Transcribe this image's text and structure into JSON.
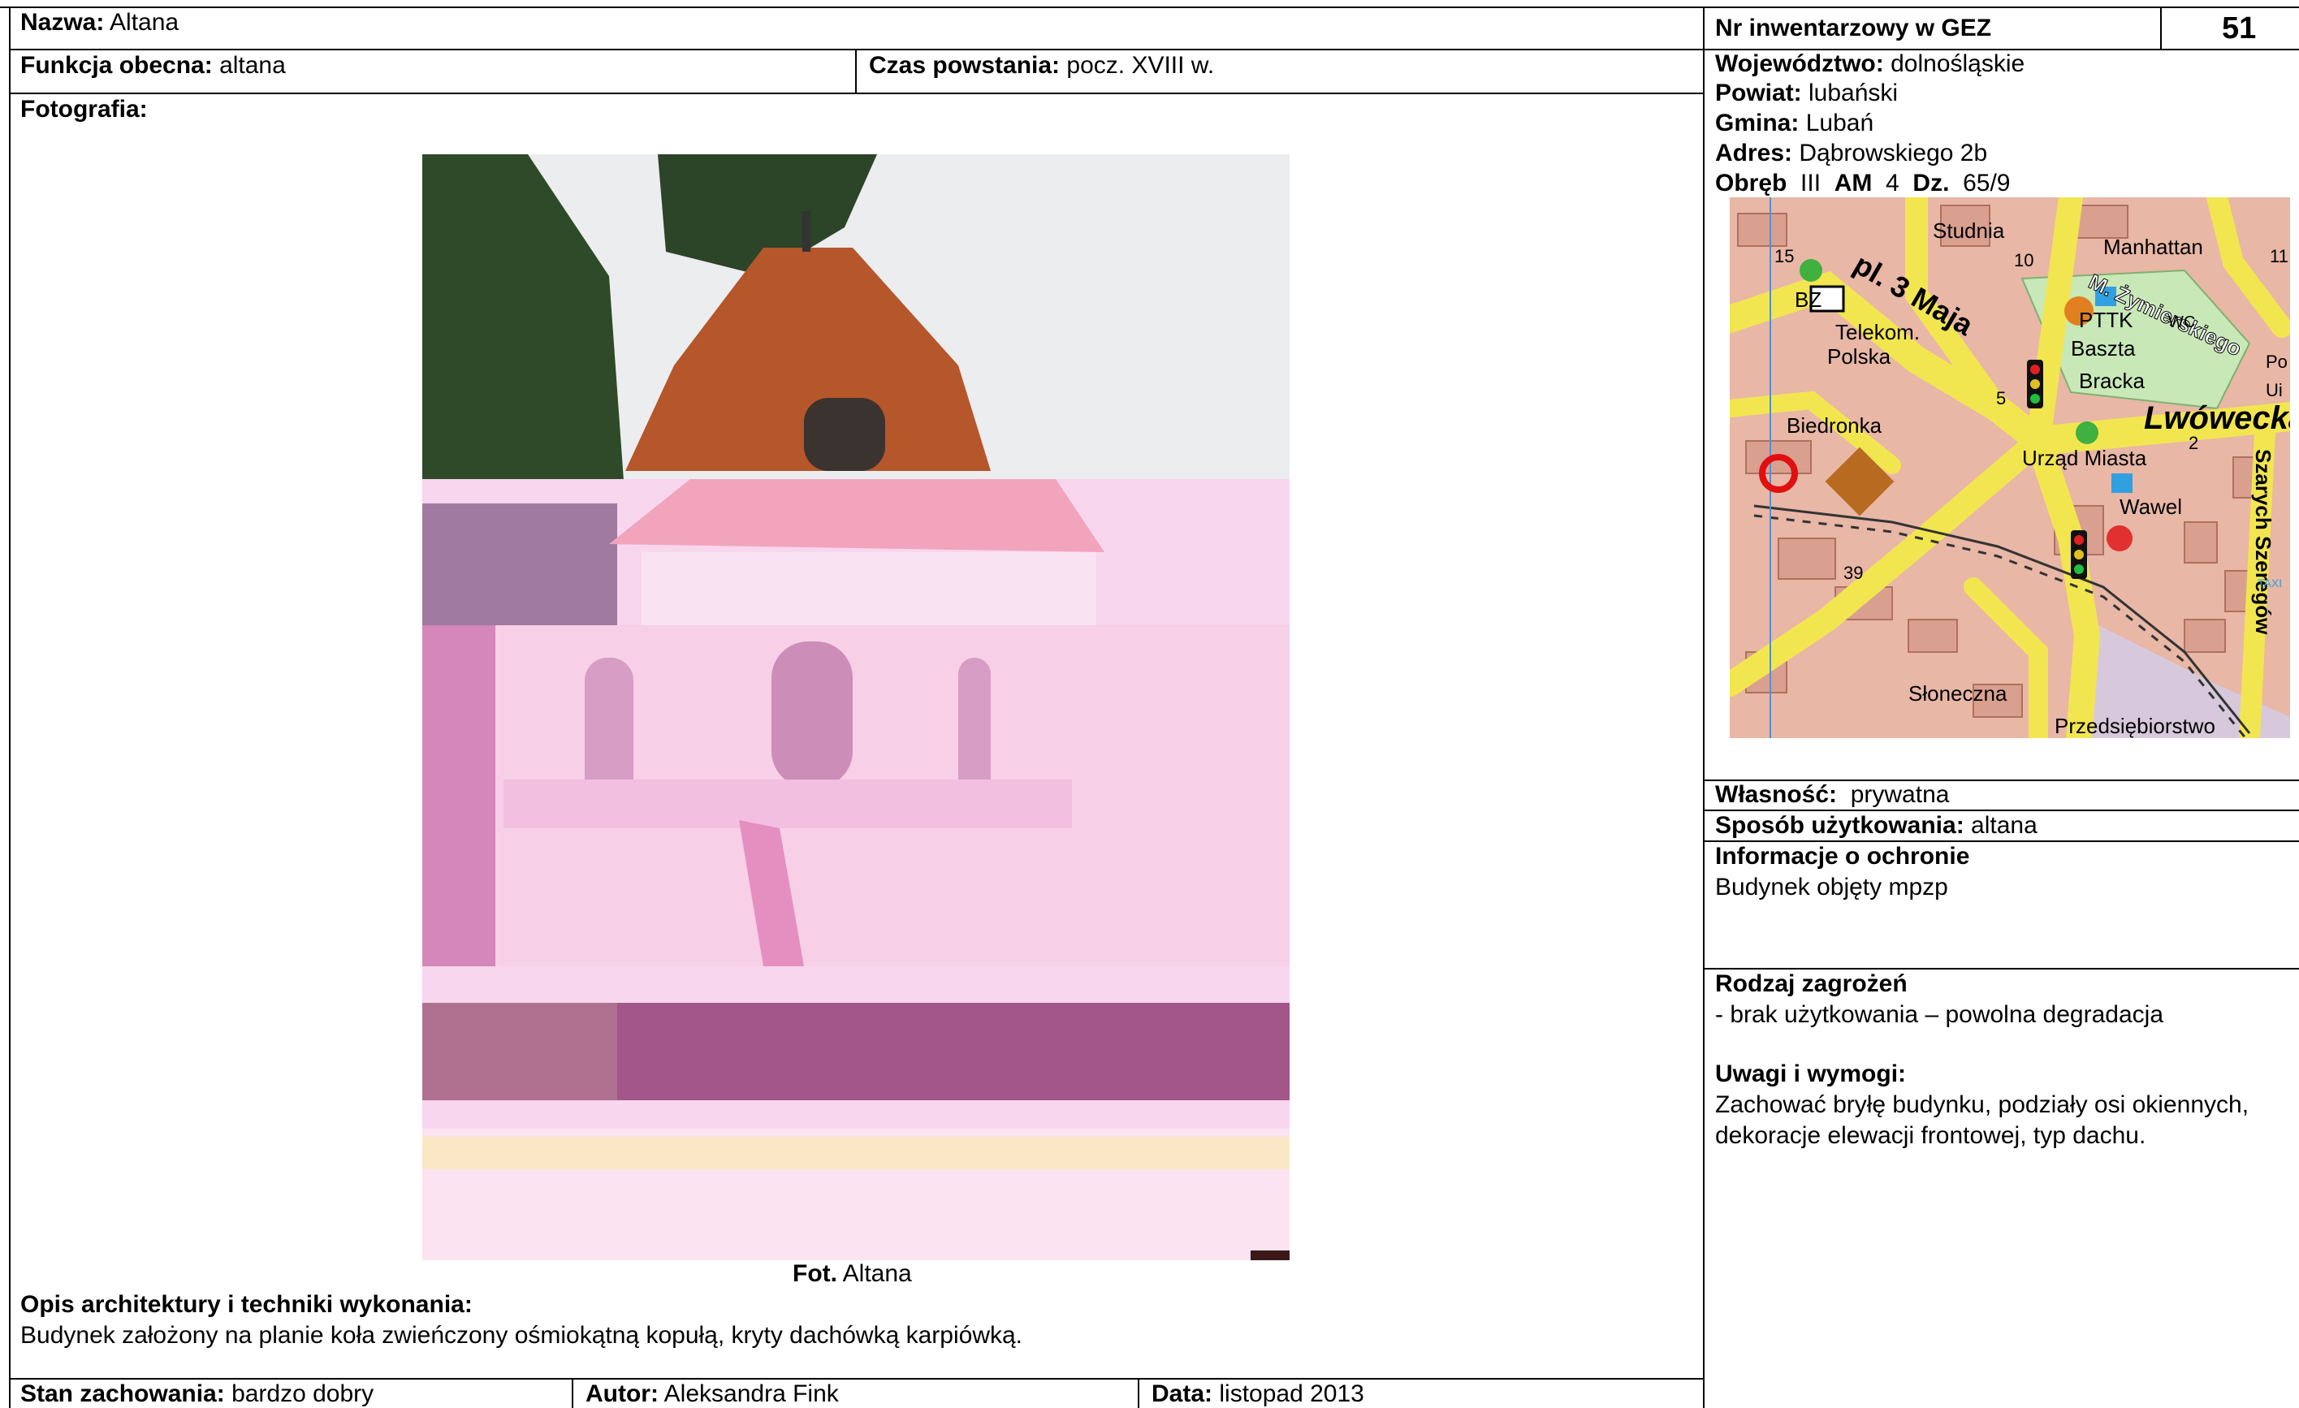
{
  "header": {
    "name_label": "Nazwa:",
    "name_value": "Altana",
    "inventory_label": "Nr inwentarzowy w GEZ",
    "inventory_value": "51"
  },
  "row2": {
    "function_label": "Funkcja obecna:",
    "function_value": "altana",
    "period_label": "Czas powstania:",
    "period_value": "pocz. XVIII w."
  },
  "location": {
    "voivodeship_label": "Województwo:",
    "voivodeship_value": "dolnośląskie",
    "county_label": "Powiat:",
    "county_value": "lubański",
    "commune_label": "Gmina:",
    "commune_value": "Lubań",
    "address_label": "Adres:",
    "address_value": "Dąbrowskiego 2b",
    "precinct_label": "Obręb",
    "precinct_value": "III",
    "am_label": "AM",
    "am_value": "4",
    "plot_label": "Dz.",
    "plot_value": "65/9"
  },
  "photo_section": {
    "label": "Fotografia:",
    "caption_label": "Fot.",
    "caption_value": "Altana"
  },
  "map": {
    "labels": [
      "Studnia",
      "Manhattan",
      "M. Żymierskiego",
      "pl. 3 Maja",
      "BZ",
      "Telekom.",
      "Polska",
      "PTTK",
      "WC",
      "Baszta",
      "Bracka",
      "Lwówecka",
      "Biedronka",
      "Urząd Miasta",
      "Wawel",
      "Szarych Szeregów",
      "Słoneczna",
      "Przedsiębiorstwo",
      "2",
      "5",
      "39",
      "10",
      "15",
      "11",
      "Po",
      "Ui",
      "TAXI"
    ]
  },
  "right_panel": {
    "ownership_label": "Własność:",
    "ownership_value": "prywatna",
    "usage_label": "Sposób użytkowania:",
    "usage_value": "altana",
    "protection_title": "Informacje o ochronie",
    "protection_text": "Budynek objęty mpzp",
    "threats_title": "Rodzaj zagrożeń",
    "threats_text": "- brak użytkowania – powolna degradacja",
    "remarks_title": "Uwagi i wymogi:",
    "remarks_line1": "Zachować bryłę budynku, podziały osi okiennych,",
    "remarks_line2": "dekoracje elewacji frontowej, typ dachu."
  },
  "description": {
    "title": "Opis architektury i techniki wykonania:",
    "text": "Budynek założony na planie koła zwieńczony ośmiokątną kopułą, kryty dachówką karpiówką."
  },
  "footer": {
    "condition_label": "Stan zachowania:",
    "condition_value": "bardzo dobry",
    "author_label": "Autor:",
    "author_value": "Aleksandra Fink",
    "date_label": "Data:",
    "date_value": "listopad 2013"
  }
}
